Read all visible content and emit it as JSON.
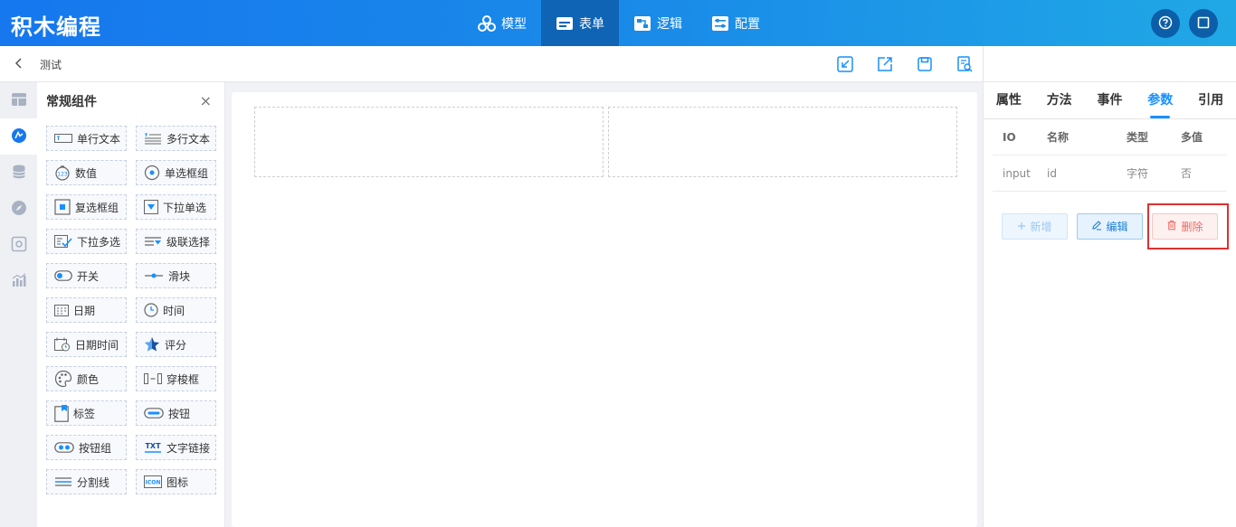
{
  "brand": "积木编程",
  "nav": [
    {
      "label": "模型",
      "icon": "cubes-icon",
      "active": false
    },
    {
      "label": "表单",
      "icon": "form-icon",
      "active": true
    },
    {
      "label": "逻辑",
      "icon": "logic-icon",
      "active": false
    },
    {
      "label": "配置",
      "icon": "config-icon",
      "active": false
    }
  ],
  "header_actions": [
    "help-icon",
    "window-icon"
  ],
  "subbar": {
    "page_name": "测试",
    "tools": [
      "import-icon",
      "export-icon",
      "save-icon",
      "preview-icon"
    ]
  },
  "rail": [
    {
      "icon": "layout-icon",
      "active": false
    },
    {
      "icon": "component-icon",
      "active": true
    },
    {
      "icon": "database-icon",
      "active": false
    },
    {
      "icon": "compass-icon",
      "active": false
    },
    {
      "icon": "settings-box-icon",
      "active": false
    },
    {
      "icon": "chart-icon",
      "active": false
    }
  ],
  "palette": {
    "title": "常规组件",
    "close": "×",
    "items": [
      {
        "label": "单行文本",
        "icon": "single-line-text-icon"
      },
      {
        "label": "多行文本",
        "icon": "multi-line-text-icon"
      },
      {
        "label": "数值",
        "icon": "number-icon"
      },
      {
        "label": "单选框组",
        "icon": "radio-group-icon"
      },
      {
        "label": "复选框组",
        "icon": "checkbox-group-icon"
      },
      {
        "label": "下拉单选",
        "icon": "dropdown-single-icon"
      },
      {
        "label": "下拉多选",
        "icon": "dropdown-multi-icon"
      },
      {
        "label": "级联选择",
        "icon": "cascader-icon"
      },
      {
        "label": "开关",
        "icon": "switch-icon"
      },
      {
        "label": "滑块",
        "icon": "slider-icon"
      },
      {
        "label": "日期",
        "icon": "date-icon"
      },
      {
        "label": "时间",
        "icon": "time-icon"
      },
      {
        "label": "日期时间",
        "icon": "datetime-icon"
      },
      {
        "label": "评分",
        "icon": "rating-icon"
      },
      {
        "label": "颜色",
        "icon": "color-icon"
      },
      {
        "label": "穿梭框",
        "icon": "transfer-icon"
      },
      {
        "label": "标签",
        "icon": "tag-icon"
      },
      {
        "label": "按钮",
        "icon": "button-icon"
      },
      {
        "label": "按钮组",
        "icon": "button-group-icon"
      },
      {
        "label": "文字链接",
        "icon": "text-link-icon"
      },
      {
        "label": "分割线",
        "icon": "divider-icon"
      },
      {
        "label": "图标",
        "icon": "icon-component-icon"
      }
    ]
  },
  "right_panel": {
    "tabs": [
      {
        "label": "属性",
        "active": false
      },
      {
        "label": "方法",
        "active": false
      },
      {
        "label": "事件",
        "active": false
      },
      {
        "label": "参数",
        "active": true
      },
      {
        "label": "引用",
        "active": false
      }
    ],
    "table": {
      "headers": [
        "IO",
        "名称",
        "类型",
        "多值"
      ],
      "rows": [
        [
          "input",
          "id",
          "字符",
          "否"
        ]
      ]
    },
    "buttons": {
      "add": "新增",
      "edit": "编辑",
      "delete": "删除"
    }
  },
  "colors": {
    "primary": "#1890ff",
    "header_active": "#0f64b5",
    "danger": "#f06a63",
    "highlight": "#e0302d"
  }
}
